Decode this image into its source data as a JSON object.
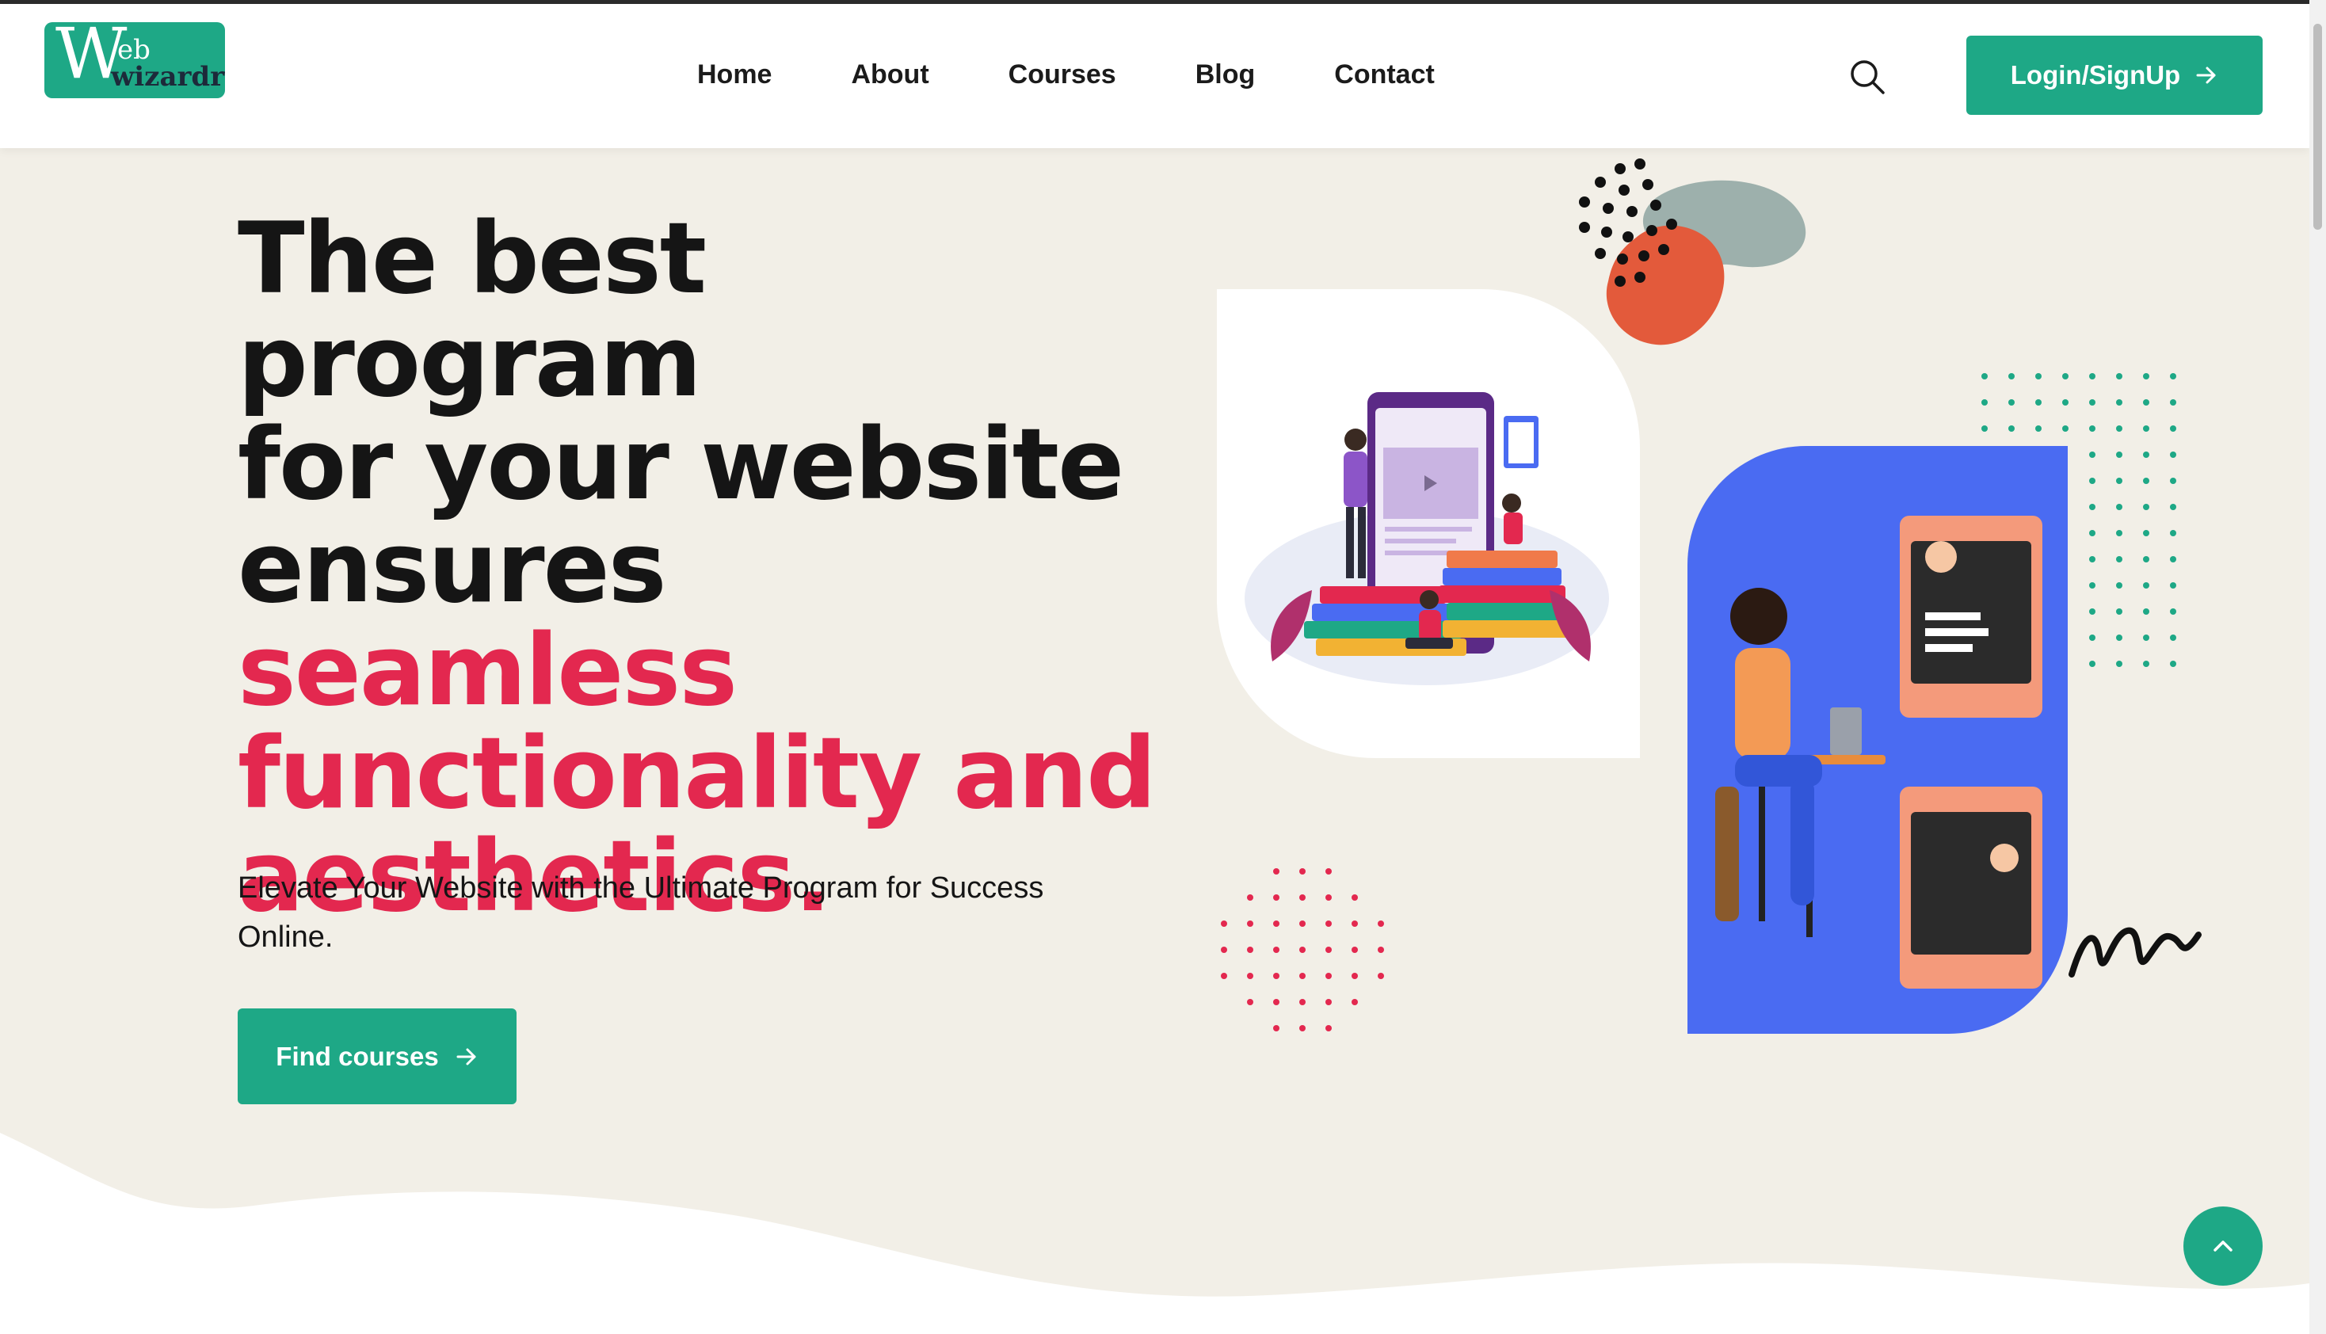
{
  "logo": {
    "big_letter": "W",
    "sup_text": "eb",
    "sub_text": "wizardry"
  },
  "nav": {
    "items": [
      "Home",
      "About",
      "Courses",
      "Blog",
      "Contact"
    ]
  },
  "header": {
    "login_label": "Login/SignUp"
  },
  "hero": {
    "headline_dark": [
      "The best program",
      "for your website",
      "ensures"
    ],
    "headline_pink": [
      "seamless",
      "functionality and",
      "aesthetics."
    ],
    "subtext": "Elevate Your Website with the Ultimate Program for Success Online.",
    "cta_label": "Find courses"
  },
  "colors": {
    "brand_green": "#1ea886",
    "accent_pink": "#e3284f",
    "hero_bg": "#f2efe7",
    "blue_card": "#4a6bf2"
  },
  "icons": {
    "search": "search-icon",
    "arrow": "arrow-right-icon",
    "scroll_top": "chevron-up-icon"
  }
}
